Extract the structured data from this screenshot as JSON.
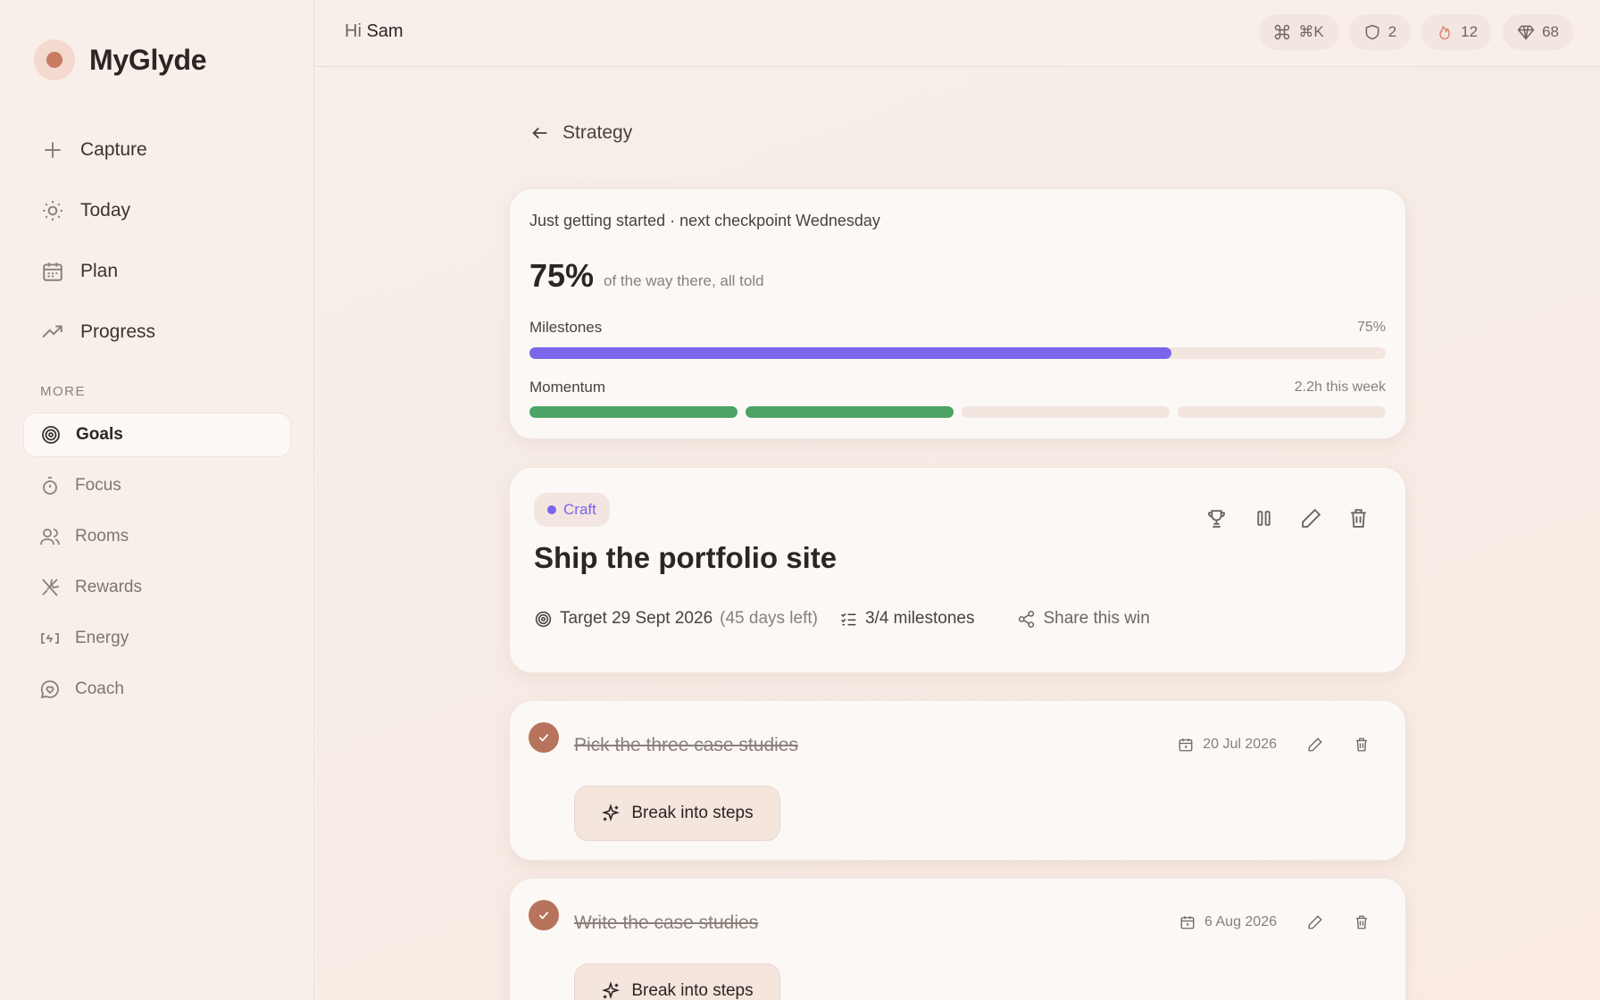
{
  "app": {
    "name": "MyGlyde"
  },
  "sidebar": {
    "main_items": [
      {
        "label": "Capture",
        "icon": "plus-icon"
      },
      {
        "label": "Today",
        "icon": "sun-icon"
      },
      {
        "label": "Plan",
        "icon": "calendar-icon"
      },
      {
        "label": "Progress",
        "icon": "trending-up-icon"
      }
    ],
    "more_label": "MORE",
    "more_items": [
      {
        "label": "Goals",
        "icon": "target-icon",
        "active": true
      },
      {
        "label": "Focus",
        "icon": "timer-icon"
      },
      {
        "label": "Rooms",
        "icon": "users-icon"
      },
      {
        "label": "Rewards",
        "icon": "utensils-icon"
      },
      {
        "label": "Energy",
        "icon": "battery-icon"
      },
      {
        "label": "Coach",
        "icon": "heart-chat-icon"
      }
    ]
  },
  "topbar": {
    "greeting_prefix": "Hi",
    "user_name": "Sam",
    "shortcut": "⌘K",
    "shields": "2",
    "streak": "12",
    "gems": "68"
  },
  "back": {
    "label": "Strategy"
  },
  "progress_card": {
    "status": "Just getting started · next checkpoint Wednesday",
    "percent": "75%",
    "percent_sub": "of the way there, all told",
    "milestones_label": "Milestones",
    "milestones_value": "75%",
    "milestones_fraction": 0.75,
    "momentum_label": "Momentum",
    "momentum_value": "2.2h this week",
    "momentum_segments": [
      true,
      true,
      false,
      false
    ],
    "milestone_color": "#7966ea",
    "momentum_color": "#4ba365"
  },
  "goal": {
    "tag": "Craft",
    "title": "Ship the portfolio site",
    "target": "Target 29 Sept 2026",
    "days_left": "(45 days left)",
    "milestones": "3/4 milestones",
    "share": "Share this win"
  },
  "milestones": [
    {
      "title": "Pick the three case studies",
      "date": "20 Jul 2026",
      "done": true,
      "action": "Break into steps"
    },
    {
      "title": "Write the case studies",
      "date": "6 Aug 2026",
      "done": true,
      "action": "Break into steps"
    }
  ]
}
